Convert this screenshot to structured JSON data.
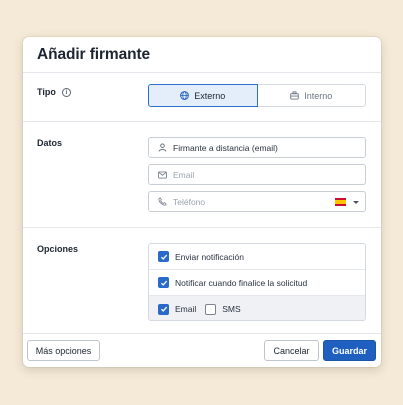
{
  "dialog": {
    "title": "Añadir firmante"
  },
  "tipo": {
    "label": "Tipo",
    "options": [
      {
        "label": "Externo",
        "icon": "globe-icon",
        "selected": true
      },
      {
        "label": "Interno",
        "icon": "briefcase-icon",
        "selected": false
      }
    ]
  },
  "datos": {
    "label": "Datos",
    "signer_type": {
      "value": "Firmante a distancia (email)",
      "icon": "person-icon"
    },
    "email": {
      "placeholder": "Email",
      "icon": "mail-icon"
    },
    "phone": {
      "placeholder": "Teléfono",
      "icon": "phone-icon",
      "country_flag": "spain-flag-icon"
    }
  },
  "opciones": {
    "label": "Opciones",
    "items": [
      {
        "label": "Enviar notificación",
        "checked": true
      },
      {
        "label": "Notificar cuando finalice la solicitud",
        "checked": true
      }
    ],
    "channels": [
      {
        "label": "Email",
        "checked": true
      },
      {
        "label": "SMS",
        "checked": false
      }
    ]
  },
  "footer": {
    "more_label": "Más opciones",
    "cancel_label": "Cancelar",
    "save_label": "Guardar"
  },
  "colors": {
    "accent": "#1e5fbf",
    "checkbox": "#2a6ac8",
    "selected_segment_bg": "#e4eefb",
    "background": "#f4ead7"
  }
}
